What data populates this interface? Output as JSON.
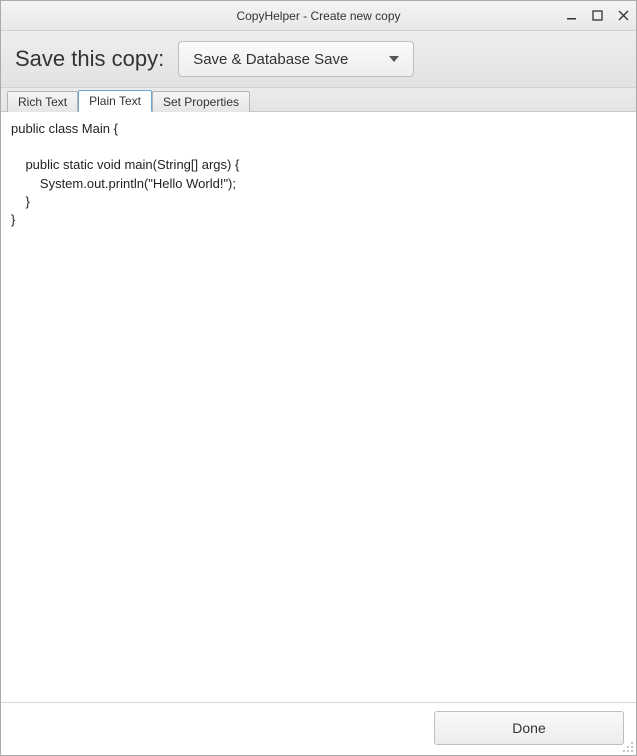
{
  "window": {
    "title": "CopyHelper - Create new copy"
  },
  "toolbar": {
    "label": "Save this copy:",
    "dropdown_value": "Save & Database Save"
  },
  "tabs": {
    "items": [
      {
        "label": "Rich Text"
      },
      {
        "label": "Plain Text"
      },
      {
        "label": "Set Properties"
      }
    ],
    "active_index": 1
  },
  "editor": {
    "text": "public class Main {\n\n    public static void main(String[] args) {\n        System.out.println(\"Hello World!\");\n    }\n}"
  },
  "footer": {
    "done_label": "Done"
  }
}
